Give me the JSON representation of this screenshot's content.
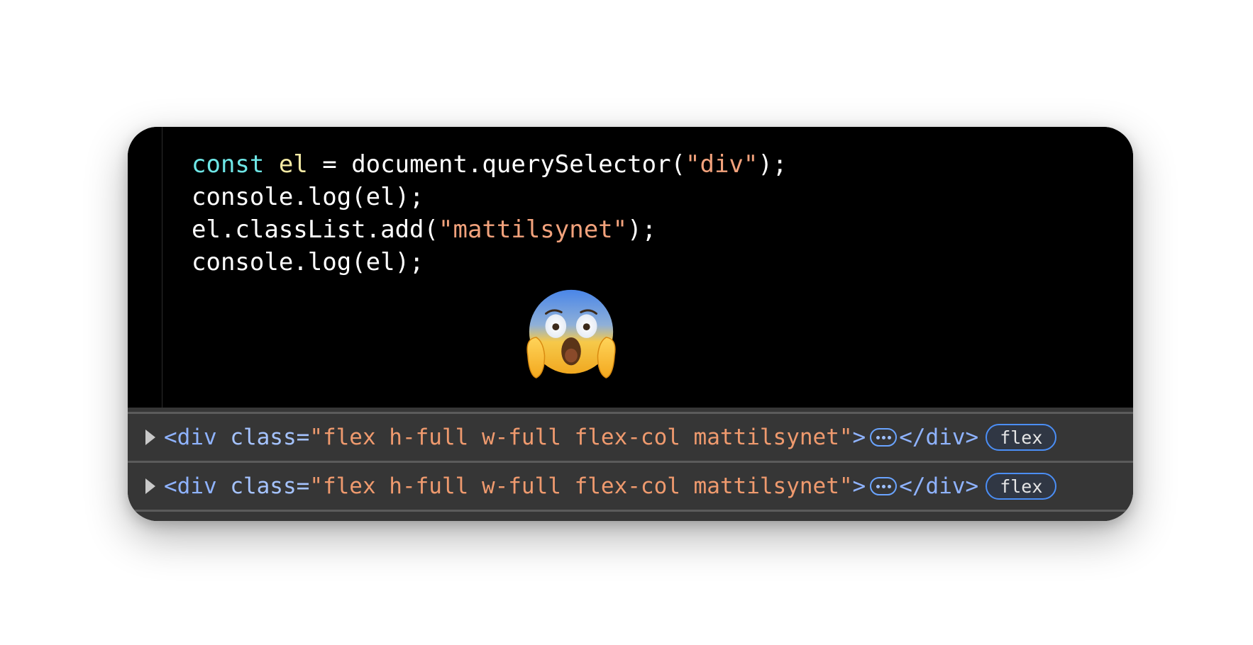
{
  "code": {
    "line1": {
      "kw": "const",
      "sp1": " ",
      "var": "el",
      "mid": " = document.querySelector(",
      "str": "\"div\"",
      "end": ");"
    },
    "line2": "console.log(el);",
    "line3": {
      "pre": "el.classList.add(",
      "str": "\"mattilsynet\"",
      "end": ");"
    },
    "line4": "console.log(el);"
  },
  "emoji": {
    "icon": "face-screaming-in-fear-icon"
  },
  "console": {
    "rows": [
      {
        "open_tag": "<div",
        "attr_name": " class",
        "eq": "=",
        "attr_value": "\"flex h-full w-full flex-col mattilsynet\"",
        "close_bracket": ">",
        "close_tag": "</div>",
        "badge": "flex"
      },
      {
        "open_tag": "<div",
        "attr_name": " class",
        "eq": "=",
        "attr_value": "\"flex h-full w-full flex-col mattilsynet\"",
        "close_bracket": ">",
        "close_tag": "</div>",
        "badge": "flex"
      }
    ]
  },
  "colors": {
    "keyword": "#6ee6e6",
    "variable": "#f3e9a4",
    "string": "#f2a27c",
    "tag": "#8fb3ff",
    "attr_value": "#ef9a6e",
    "badge_border": "#4b8ef5",
    "console_bg": "#363636"
  }
}
